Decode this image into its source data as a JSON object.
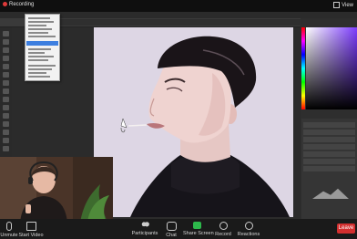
{
  "zoom": {
    "recording_label": "Recording",
    "view_label": "View",
    "toolbar": {
      "mute_label": "Unmute",
      "video_label": "Start Video",
      "participants_label": "Participants",
      "chat_label": "Chat",
      "share_label": "Share Screen",
      "record_label": "Record",
      "reactions_label": "Reactions",
      "leave_label": "Leave"
    }
  },
  "colors": {
    "accent_share": "#2db84b",
    "leave_red": "#d32f2f",
    "menu_highlight": "#3d7fe0",
    "recording_dot": "#e03a3a"
  }
}
